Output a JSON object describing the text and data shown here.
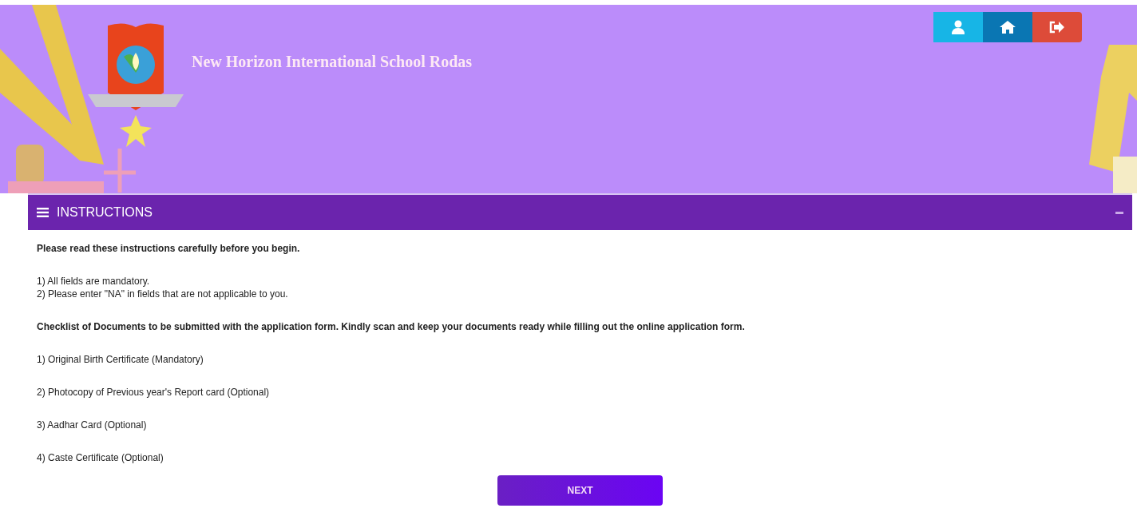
{
  "header": {
    "school_name": "New Horizon International School Rodas"
  },
  "nav_buttons": [
    {
      "kind": "user"
    },
    {
      "kind": "home"
    },
    {
      "kind": "logout"
    }
  ],
  "panel": {
    "title": "INSTRUCTIONS",
    "intro": "Please read these instructions carefully before you begin.",
    "rules": [
      "1) All fields are mandatory.",
      "2) Please enter \"NA\" in fields that are not applicable to you."
    ],
    "checklist_heading": "Checklist of Documents to be submitted with the application form. Kindly scan and keep your documents ready while filling out the online application form.",
    "documents": [
      "1) Original Birth Certificate (Mandatory)",
      "2) Photocopy of Previous year's Report card (Optional)",
      "3) Aadhar Card (Optional)",
      "4) Caste Certificate (Optional)"
    ],
    "next_button": "NEXT"
  }
}
